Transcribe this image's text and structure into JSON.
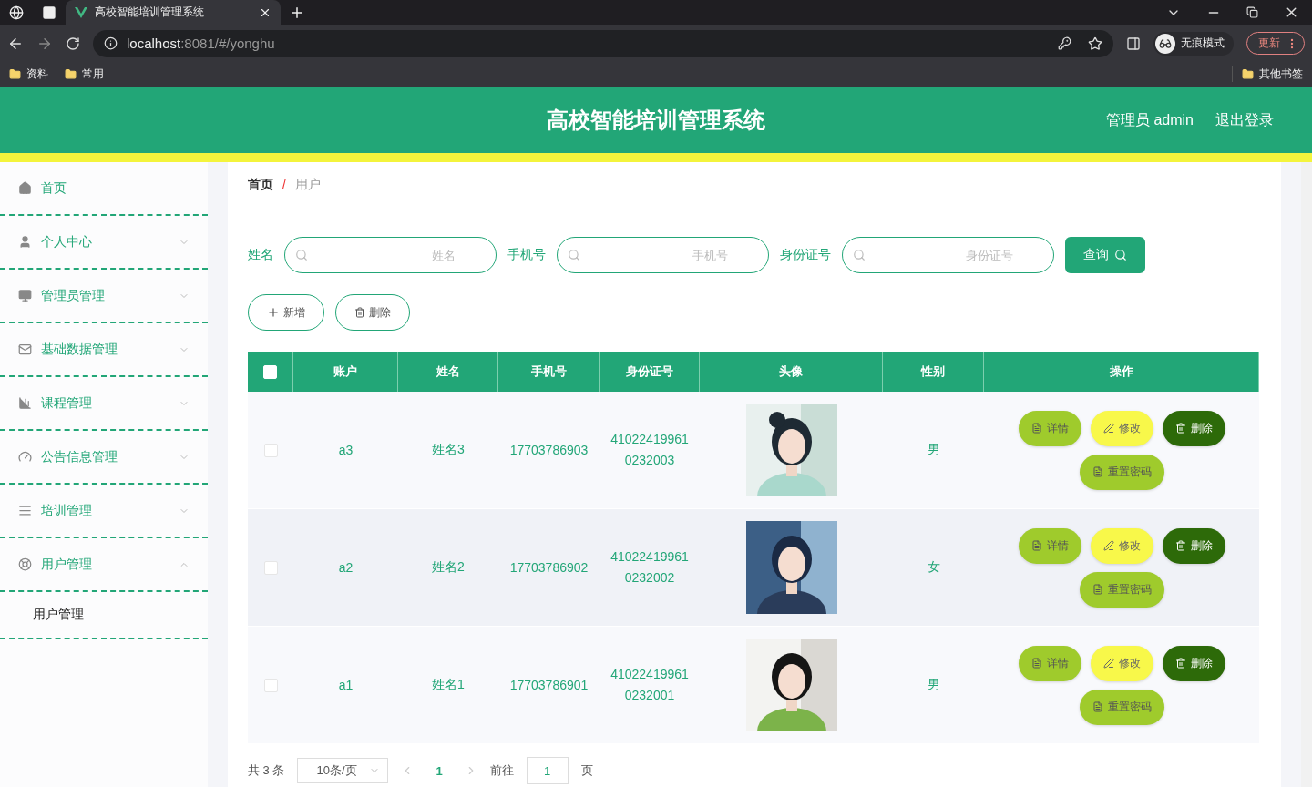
{
  "browser": {
    "tab_title": "高校智能培训管理系统",
    "url_host": "localhost",
    "url_rest": ":8081/#/yonghu",
    "incognito": "无痕模式",
    "update": "更新",
    "bookmarks": [
      "资料",
      "常用"
    ],
    "other_bookmarks": "其他书签"
  },
  "header": {
    "title": "高校智能培训管理系统",
    "user": "管理员 admin",
    "logout": "退出登录"
  },
  "sidebar": {
    "items": [
      {
        "label": "首页",
        "kind": "link"
      },
      {
        "label": "个人中心",
        "kind": "menu",
        "expanded": false
      },
      {
        "label": "管理员管理",
        "kind": "menu",
        "expanded": false
      },
      {
        "label": "基础数据管理",
        "kind": "menu",
        "expanded": false
      },
      {
        "label": "课程管理",
        "kind": "menu",
        "expanded": false
      },
      {
        "label": "公告信息管理",
        "kind": "menu",
        "expanded": false
      },
      {
        "label": "培训管理",
        "kind": "menu",
        "expanded": false
      },
      {
        "label": "用户管理",
        "kind": "menu",
        "expanded": true,
        "children": [
          {
            "label": "用户管理"
          }
        ]
      }
    ]
  },
  "breadcrumb": {
    "items": [
      "首页",
      "用户"
    ],
    "separator": "/"
  },
  "search": {
    "fields": [
      {
        "label": "姓名",
        "placeholder": "姓名"
      },
      {
        "label": "手机号",
        "placeholder": "手机号"
      },
      {
        "label": "身份证号",
        "placeholder": "身份证号"
      }
    ],
    "button": "查询"
  },
  "actions": [
    {
      "label": "新增",
      "kind": "add"
    },
    {
      "label": "删除",
      "kind": "delete"
    }
  ],
  "table": {
    "all_checked": false,
    "columns": [
      "账户",
      "姓名",
      "手机号",
      "身份证号",
      "头像",
      "性别",
      "操作"
    ],
    "rows": [
      {
        "checked": false,
        "account": "a3",
        "name": "姓名3",
        "phone": "17703786903",
        "id_number": "410224199610232003",
        "gender": "男",
        "buttons": [
          {
            "label": "详情",
            "kind": "detail"
          },
          {
            "label": "修改",
            "kind": "edit"
          },
          {
            "label": "删除",
            "kind": "delete"
          },
          {
            "label": "重置密码",
            "kind": "reset"
          }
        ]
      },
      {
        "checked": false,
        "account": "a2",
        "name": "姓名2",
        "phone": "17703786902",
        "id_number": "410224199610232002",
        "gender": "女",
        "buttons": [
          {
            "label": "详情",
            "kind": "detail"
          },
          {
            "label": "修改",
            "kind": "edit"
          },
          {
            "label": "删除",
            "kind": "delete"
          },
          {
            "label": "重置密码",
            "kind": "reset"
          }
        ]
      },
      {
        "checked": false,
        "account": "a1",
        "name": "姓名1",
        "phone": "17703786901",
        "id_number": "410224199610232001",
        "gender": "男",
        "buttons": [
          {
            "label": "详情",
            "kind": "detail"
          },
          {
            "label": "修改",
            "kind": "edit"
          },
          {
            "label": "删除",
            "kind": "delete"
          },
          {
            "label": "重置密码",
            "kind": "reset"
          }
        ]
      }
    ]
  },
  "pagination": {
    "total": "共 3 条",
    "page_size": "10条/页",
    "pages": [
      {
        "label": "1",
        "selected": true
      }
    ],
    "goto_label": "前往",
    "goto_value": "1",
    "goto_suffix": "页"
  }
}
